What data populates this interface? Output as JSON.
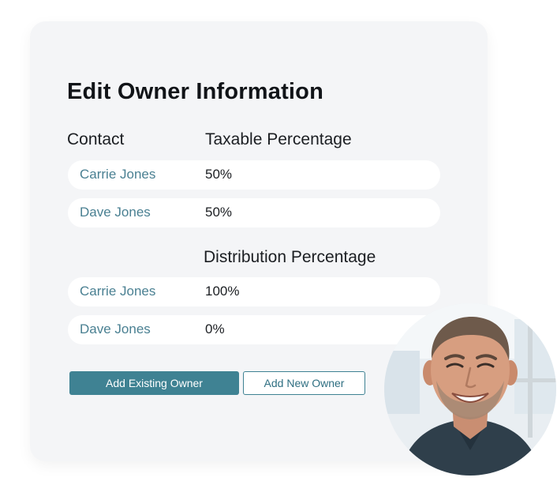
{
  "dialog": {
    "title": "Edit Owner Information",
    "contact_header": "Contact",
    "taxable_header": "Taxable Percentage",
    "distribution_header": "Distribution Percentage",
    "taxable_rows": [
      {
        "name": "Carrie Jones",
        "percent": "50%"
      },
      {
        "name": "Dave Jones",
        "percent": "50%"
      }
    ],
    "distribution_rows": [
      {
        "name": "Carrie Jones",
        "percent": "100%"
      },
      {
        "name": "Dave Jones",
        "percent": "0%"
      }
    ],
    "buttons": {
      "add_existing": "Add Existing Owner",
      "add_new": "Add New Owner"
    }
  },
  "colors": {
    "accent": "#3f8293",
    "contact_link": "#4a8092",
    "card_background": "#f4f5f7"
  },
  "icons": {
    "profile_photo": "user-avatar-photo"
  }
}
